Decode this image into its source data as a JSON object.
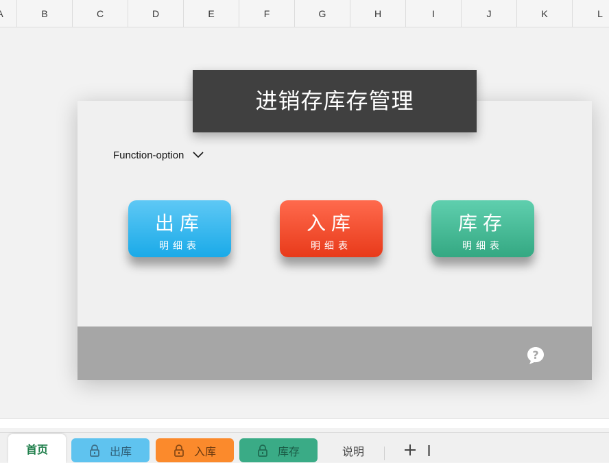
{
  "columns": [
    "A",
    "B",
    "C",
    "D",
    "E",
    "F",
    "G",
    "H",
    "I",
    "J",
    "K",
    "L"
  ],
  "title": "进销存库存管理",
  "function_option": {
    "label": "Function-option"
  },
  "buttons": {
    "out": {
      "main": "出库",
      "sub": "明细表"
    },
    "in": {
      "main": "入库",
      "sub": "明细表"
    },
    "stock": {
      "main": "库存",
      "sub": "明细表"
    }
  },
  "tabs": {
    "home": "首页",
    "out": "出库",
    "in": "入库",
    "stock": "库存",
    "help": "说明"
  },
  "colors": {
    "title_bg": "#404040",
    "out": "#1aaae8",
    "in": "#e83a1a",
    "stock": "#34a882",
    "footer": "#a6a6a6"
  },
  "icons": {
    "dropdown": "chevron-down-icon",
    "help": "help-bubble-icon",
    "lock": "lock-icon",
    "add": "plus-icon"
  }
}
